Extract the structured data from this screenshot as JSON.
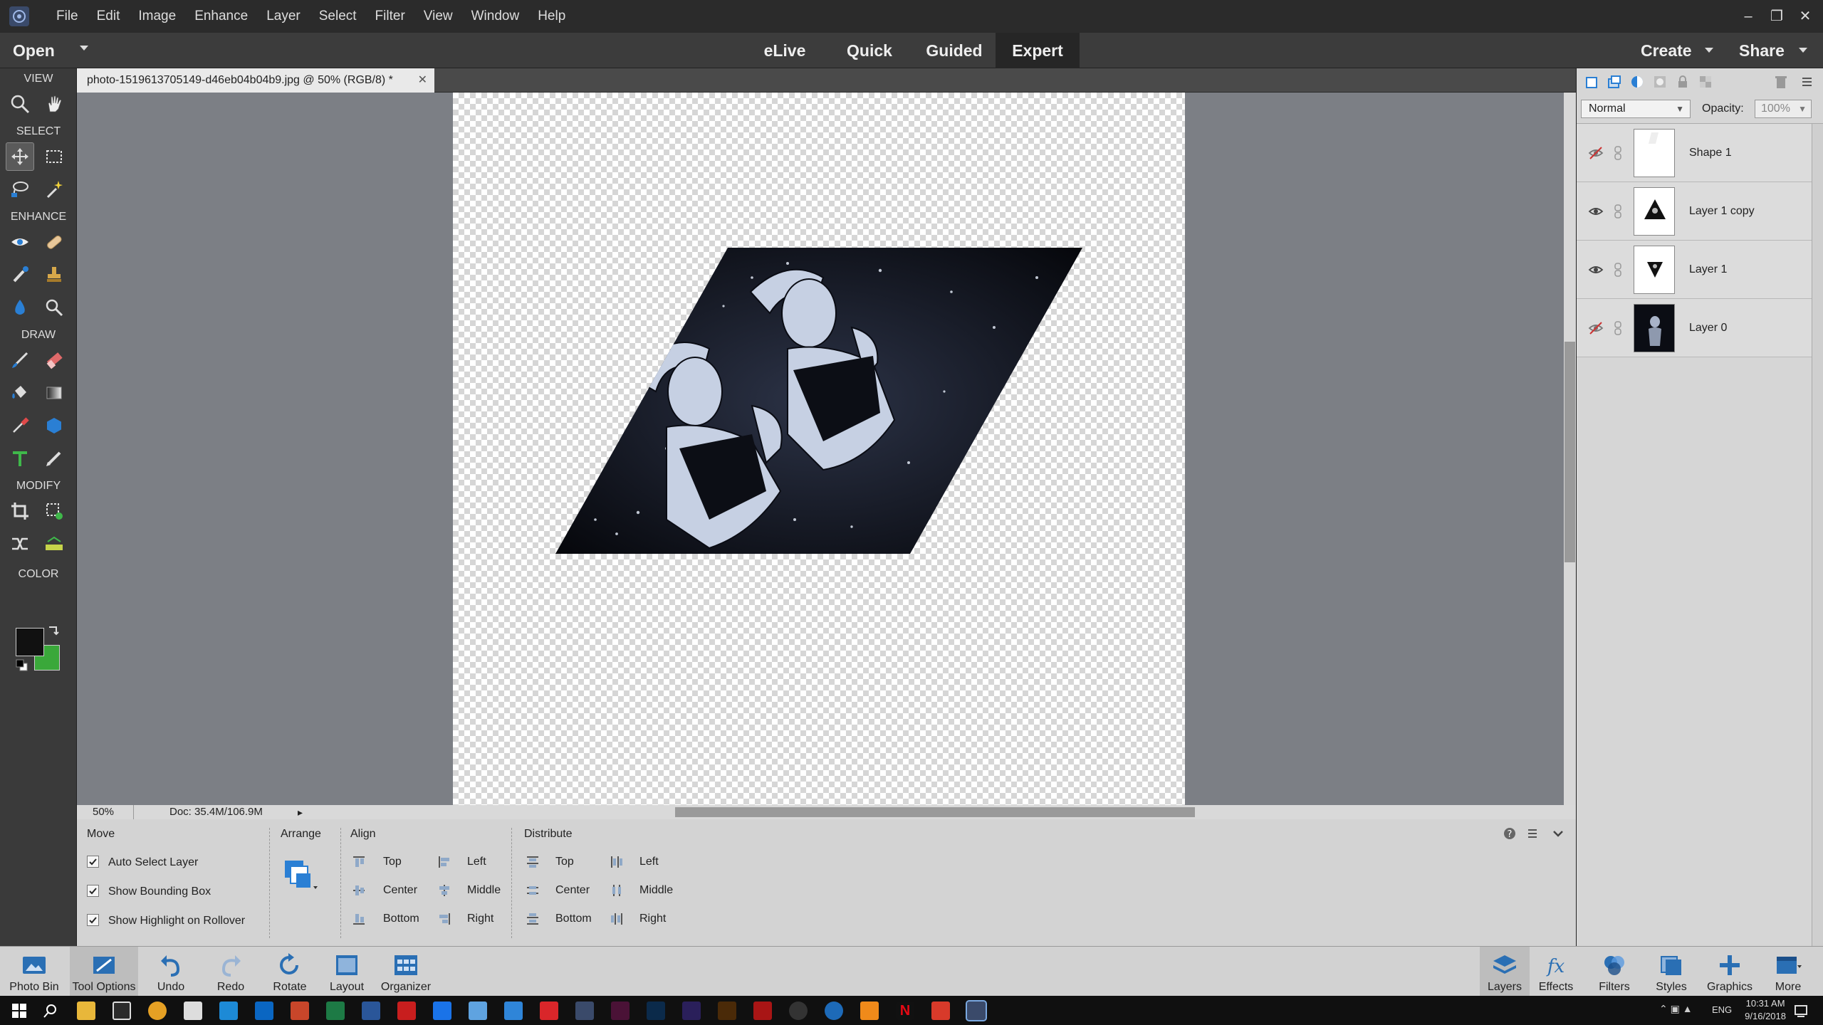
{
  "menubar": {
    "items": [
      "File",
      "Edit",
      "Image",
      "Enhance",
      "Layer",
      "Select",
      "Filter",
      "View",
      "Window",
      "Help"
    ]
  },
  "modebar": {
    "open": "Open",
    "tabs": [
      "eLive",
      "Quick",
      "Guided",
      "Expert"
    ],
    "active_tab": "Expert",
    "create": "Create",
    "share": "Share"
  },
  "toolbox": {
    "sections": [
      "VIEW",
      "SELECT",
      "ENHANCE",
      "DRAW",
      "MODIFY",
      "COLOR"
    ]
  },
  "document": {
    "tab_title": "photo-1519613705149-d46eb04b04b9.jpg @ 50% (RGB/8) *",
    "zoom": "50%",
    "doc_size": "Doc: 35.4M/106.9M"
  },
  "tool_options": {
    "tool_name": "Move",
    "checkboxes": [
      {
        "label": "Auto Select Layer",
        "checked": true
      },
      {
        "label": "Show Bounding Box",
        "checked": true
      },
      {
        "label": "Show Highlight on Rollover",
        "checked": true
      }
    ],
    "arrange": "Arrange",
    "align": {
      "title": "Align",
      "col1": [
        "Top",
        "Center",
        "Bottom"
      ],
      "col2": [
        "Left",
        "Middle",
        "Right"
      ]
    },
    "distribute": {
      "title": "Distribute",
      "col1": [
        "Top",
        "Center",
        "Bottom"
      ],
      "col2": [
        "Left",
        "Middle",
        "Right"
      ]
    }
  },
  "layers_panel": {
    "blend_mode": "Normal",
    "opacity_label": "Opacity:",
    "opacity_value": "100%",
    "layers": [
      {
        "name": "Shape 1",
        "visible": false
      },
      {
        "name": "Layer 1 copy",
        "visible": true
      },
      {
        "name": "Layer 1",
        "visible": true
      },
      {
        "name": "Layer 0",
        "visible": false
      }
    ]
  },
  "bottombar": {
    "left": [
      "Photo Bin",
      "Tool Options",
      "Undo",
      "Redo",
      "Rotate",
      "Layout",
      "Organizer"
    ],
    "right": [
      "Layers",
      "Effects",
      "Filters",
      "Styles",
      "Graphics",
      "More"
    ]
  },
  "taskbar": {
    "lang": "ENG",
    "time": "10:31 AM",
    "date": "9/16/2018"
  },
  "colors": {
    "foreground": "#111111",
    "background": "#3aa83a",
    "accent": "#2a7fd4"
  }
}
